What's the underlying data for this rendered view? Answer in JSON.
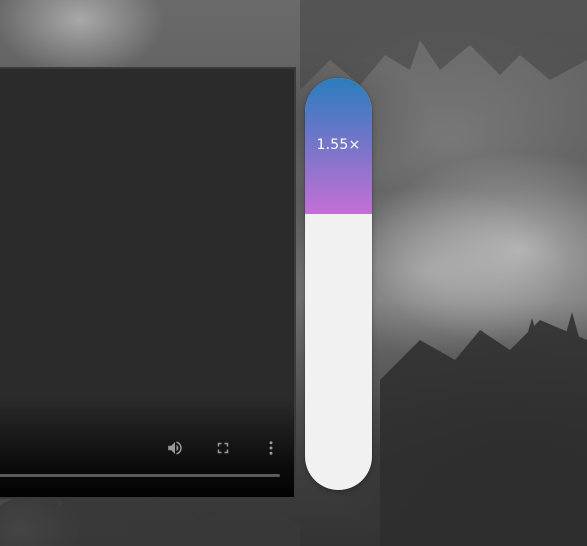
{
  "speed_control": {
    "value_label": "1.55×",
    "fill_fraction": 0.33,
    "gradient_top": "#2a7dbd",
    "gradient_bottom": "#c46fd6"
  },
  "player": {
    "progress_fraction": 0.0,
    "icons": {
      "volume": "volume-icon",
      "fullscreen": "fullscreen-icon",
      "more": "more-vertical-icon"
    }
  }
}
